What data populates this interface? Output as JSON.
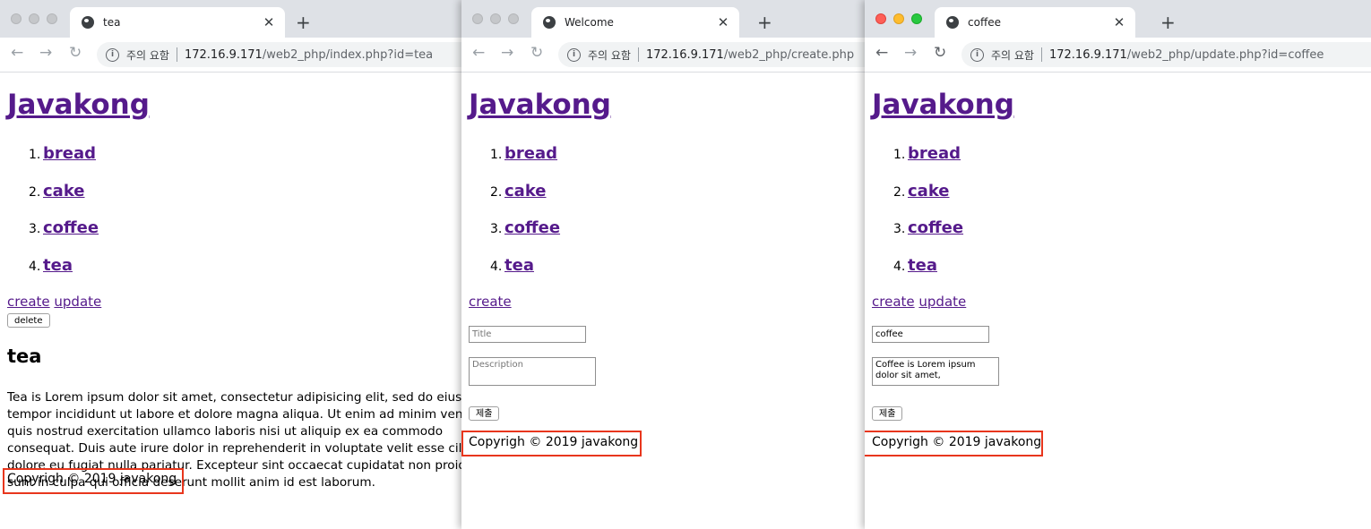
{
  "site_title": "Javakong",
  "topics": [
    "bread",
    "cake",
    "coffee",
    "tea"
  ],
  "numbers": [
    "1.",
    "2.",
    "3.",
    "4."
  ],
  "footer": "Copyrigh © 2019 javakong",
  "security_label": "주의 요함",
  "windows": [
    {
      "tab_title": "tea",
      "host": "172.16.9.171",
      "path": "/web2_php/index.php?id=tea",
      "links": [
        "create",
        "update"
      ],
      "delete_label": "delete",
      "article_title": "tea",
      "description": "Tea is Lorem ipsum dolor sit amet, consectetur adipisicing elit, sed do eiusmod tempor incididunt ut labore et dolore magna aliqua. Ut enim ad minim veniam, quis nostrud exercitation ullamco laboris nisi ut aliquip ex ea commodo consequat. Duis aute irure dolor in reprehenderit in voluptate velit esse cillum dolore eu fugiat nulla pariatur. Excepteur sint occaecat cupidatat non proident, sunt in culpa qui officia deserunt mollit anim id est laborum."
    },
    {
      "tab_title": "Welcome",
      "host": "172.16.9.171",
      "path": "/web2_php/create.php",
      "links": [
        "create"
      ],
      "title_placeholder": "Title",
      "description_placeholder": "Description",
      "submit_label": "제출"
    },
    {
      "tab_title": "coffee",
      "host": "172.16.9.171",
      "path": "/web2_php/update.php?id=coffee",
      "links": [
        "create",
        "update"
      ],
      "title_value": "coffee",
      "description_value": "Coffee is Lorem ipsum dolor sit amet,",
      "submit_label": "제출"
    }
  ],
  "colors": {
    "link_visited": "#551a8b",
    "highlight": "#e8361d",
    "tab_strip": "#dee1e6"
  }
}
